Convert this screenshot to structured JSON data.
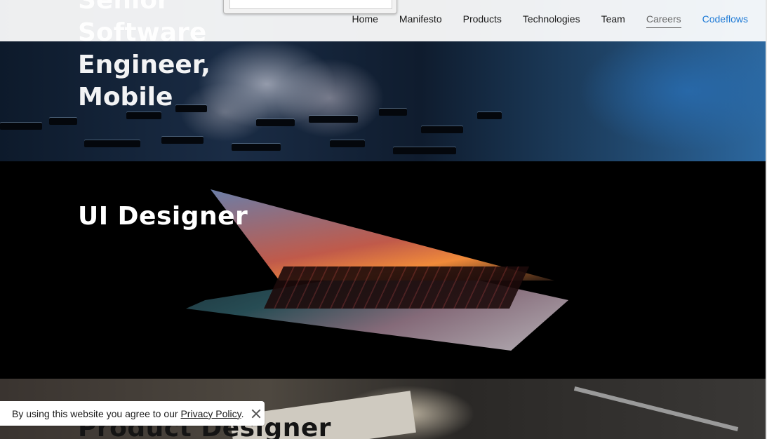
{
  "header": {
    "partial_title": "Senior Software\nEngineer, Mobile",
    "nav": [
      {
        "label": "Home"
      },
      {
        "label": "Manifesto"
      },
      {
        "label": "Products"
      },
      {
        "label": "Technologies"
      },
      {
        "label": "Team"
      },
      {
        "label": "Careers",
        "state": "active"
      },
      {
        "label": "Codeflows",
        "state": "accent"
      }
    ]
  },
  "sections": {
    "keyboard": {
      "title": "Senior Software Engineer, Mobile"
    },
    "laptop": {
      "title": "UI Designer"
    },
    "product": {
      "title": "Product Designer"
    }
  },
  "cookie": {
    "text_before": "By using this website you agree to our ",
    "link_label": "Privacy Policy",
    "text_after": "."
  },
  "colors": {
    "accent": "#1e7ad6",
    "active_nav": "#6a6a6a"
  }
}
